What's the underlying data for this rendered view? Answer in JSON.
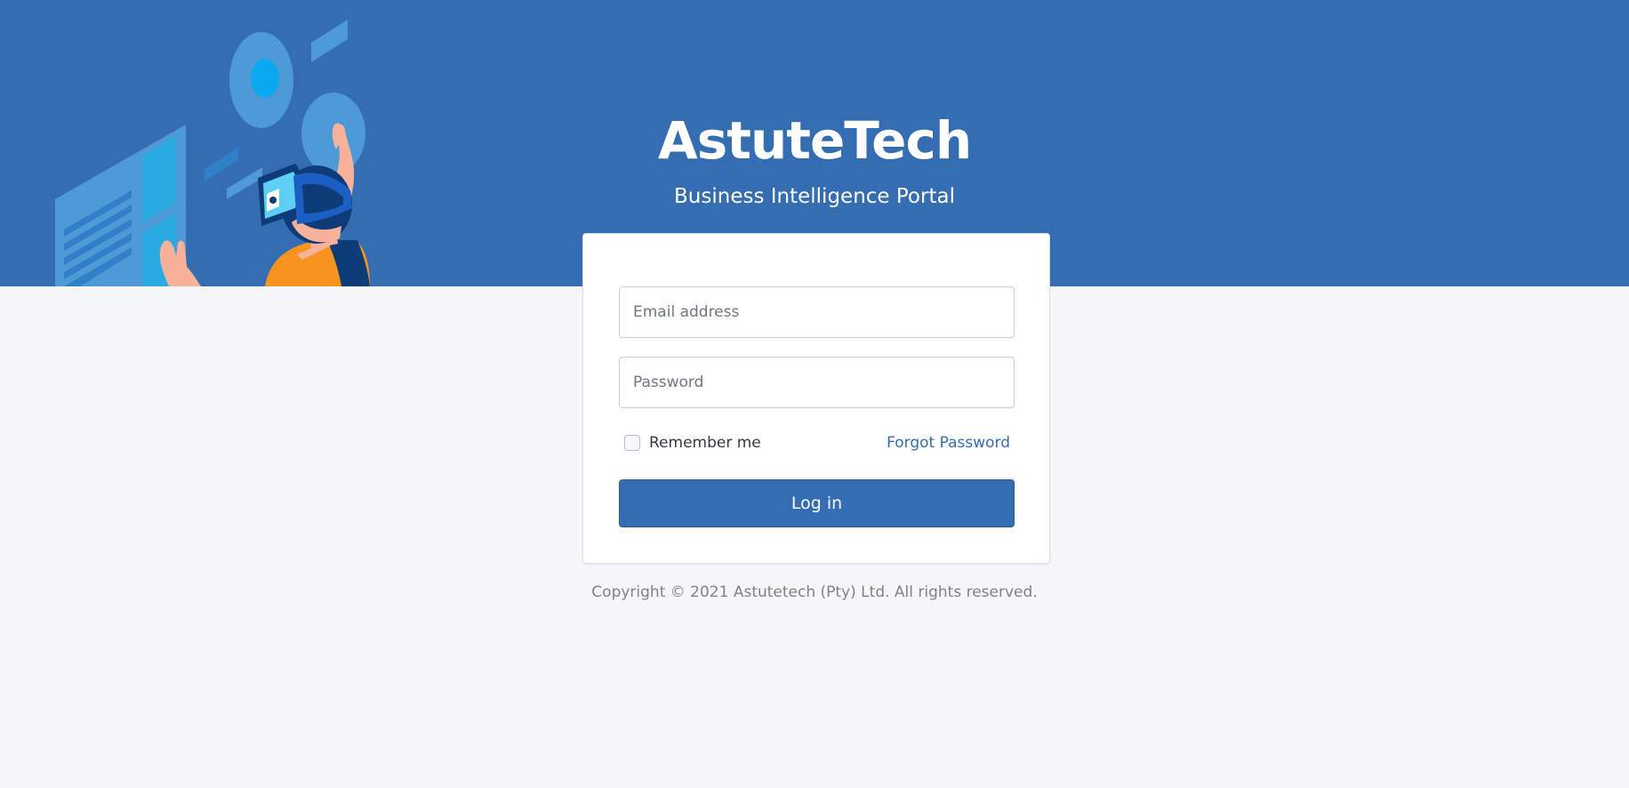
{
  "brand": {
    "title": "AstuteTech",
    "subtitle": "Business Intelligence Portal"
  },
  "login_form": {
    "email_placeholder": "Email address",
    "email_value": "",
    "password_placeholder": "Password",
    "password_value": "",
    "remember_label": "Remember me",
    "remember_checked": false,
    "forgot_label": "Forgot Password",
    "submit_label": "Log in"
  },
  "footer": {
    "copyright": "Copyright © 2021 Astutetech (Pty) Ltd. All rights reserved."
  },
  "theme": {
    "primary": "#346db1",
    "background": "#f5f6f8",
    "card": "#ffffff",
    "illustration_accent": "#f7931e",
    "illustration_light": "#29abe2"
  },
  "illustration": {
    "icon": "vr-user-illustration"
  }
}
